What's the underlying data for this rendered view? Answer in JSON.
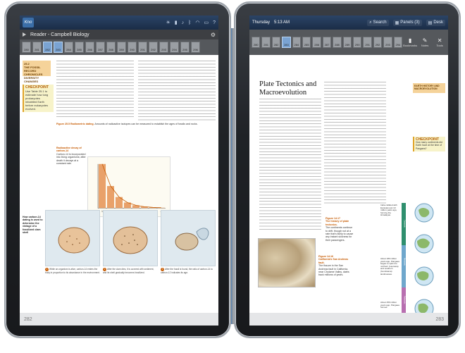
{
  "left": {
    "topbar": {
      "logo": "Kno"
    },
    "titlebar": {
      "title": "Reader - Campbell Biology"
    },
    "page_strip": [
      "280",
      "281",
      "282",
      "283",
      "284",
      "285",
      "286",
      "287",
      "288",
      "289",
      "290",
      "291",
      "292",
      "293",
      "294",
      "295",
      "296"
    ],
    "active_pages": [
      "282",
      "283"
    ],
    "orange_box": {
      "number": "25.2",
      "title": "THE FOSSIL RECORD CHRONICLES DIVERSITY CHANGES"
    },
    "checkpoint": {
      "label": "CHECKPOINT",
      "text": "Use Table 25.1 to estimate how long prokaryotes inhabited Earth before eukaryotes evolved."
    },
    "figure": {
      "number": "Figure 25.5",
      "title": "Radiometric dating.",
      "caption": "Amounts of radioactive isotopes can be measured to establish the ages of fossils and rocks."
    },
    "chart_box": {
      "title": "Radioactive decay of carbon-14",
      "desc": "Carbon-14 is incorporated into living organisms; after death it decays at a constant rate."
    },
    "side_note": "How carbon-14 dating is used to determine the vintage of a fossilized clam shell",
    "panels": [
      {
        "n": "1",
        "text": "While an organism is alive, carbon-14 enters the body in proportion to its abundance in the environment."
      },
      {
        "n": "2",
        "text": "After the clam dies, it is covered with sediment, and its shell gradually becomes fossilized."
      },
      {
        "n": "3",
        "text": "After the fossil is found, the ratio of carbon-14 to carbon-12 indicates its age."
      }
    ],
    "page_number": "282"
  },
  "chart_data": {
    "type": "bar",
    "categories": [
      "1",
      "2",
      "3",
      "4",
      "5",
      "6",
      "7",
      "8"
    ],
    "values": [
      100,
      50,
      25,
      12.5,
      6.25,
      3.1,
      1.6,
      0.8
    ],
    "ylim": [
      0,
      100
    ],
    "grid": false,
    "legend": "none",
    "colors": {
      "bars": "#e9a16a",
      "curve": "#c65a00"
    }
  },
  "right": {
    "topbar": {
      "day": "Thursday",
      "time": "5:13 AM",
      "search": "Search",
      "panels": "Panels (3)",
      "desk": "Desk"
    },
    "page_strip": [
      "280",
      "281",
      "282",
      "283",
      "284",
      "285",
      "286",
      "287",
      "288",
      "289",
      "290",
      "291",
      "292",
      "293",
      "294"
    ],
    "active_pages": [
      "283"
    ],
    "strip_icons": [
      "Bookmarks",
      "Notes",
      "Tools"
    ],
    "title": "Plate Tectonics and Macroevolution",
    "orange_box": {
      "title": "EARTH HISTORY AND MACROEVOLUTION"
    },
    "checkpoint": {
      "label": "CHECKPOINT",
      "text": "How many continents did Earth have at the time of Pangaea?"
    },
    "fig_a": {
      "number": "Figure 14.17",
      "title": "The history of plate tectonics.",
      "text": "The continents continue to drift, though not at a rate that's likely to cause any instant sickness for their passengers."
    },
    "fig_b": {
      "number": "Figure 14.16",
      "title": "California's San Andreas fault.",
      "text": "The fissure in the San Andreas fault in California, near Cholame Valley, dates back millions of years."
    },
    "globe_labels": [
      "Cenozoic",
      "Mesozoic",
      "Paleozoic",
      "India collided with Eurasian just 10 million years ago, forming the Himalayas.",
      "About 180 million years ago, Pangaea began to split into northern (Laurasia) and southern (Gondwana) landmasses.",
      "About 250 million years ago, Pangaea formed."
    ],
    "page_number": "283"
  }
}
